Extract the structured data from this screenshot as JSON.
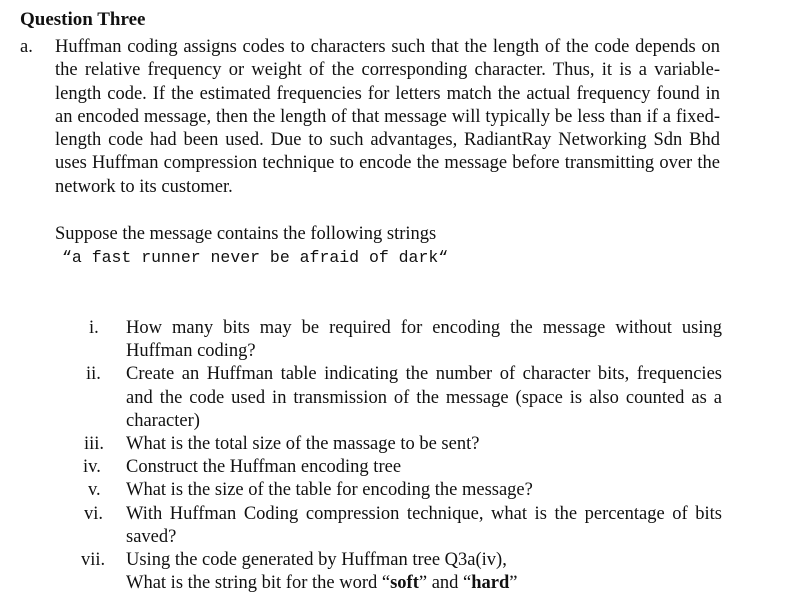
{
  "heading": "Question Three",
  "part": {
    "label": "a.",
    "paragraph": "Huffman coding assigns codes to characters such that the length of the code depends on the relative frequency or weight of the corresponding character. Thus, it is a variable-length code. If the estimated frequencies for letters match the actual frequency found in an encoded message, then the length of that message will typically be less than if a fixed-length code had been used. Due to such advantages, RadiantRay Networking Sdn Bhd  uses Huffman compression technique to encode the message before transmitting over the network to its customer.",
    "intro": "Suppose the message contains the following strings",
    "message_string": "“a fast runner never be afraid of dark“"
  },
  "questions": [
    {
      "num": "i.",
      "text": "How many bits may be required for encoding the message without using Huffman coding?"
    },
    {
      "num": "ii.",
      "text": "Create an Huffman table indicating  the number of character bits, frequencies and the code used in transmission of the message (space is also counted as a character)"
    },
    {
      "num": "iii.",
      "text": "What is the total size of the massage to be sent?"
    },
    {
      "num": "iv.",
      "text": "Construct the Huffman encoding tree"
    },
    {
      "num": "v.",
      "text": "What is the size of the table for encoding the message?"
    },
    {
      "num": "vi.",
      "text": "With Huffman Coding compression technique, what is the percentage of bits saved?"
    },
    {
      "num": "vii.",
      "text_line1": "Using the code generated by Huffman tree Q3a(iv),",
      "text_line2_prefix": "What is the string bit for the word “",
      "word1": "soft",
      "text_between": "” and “",
      "word2": "hard",
      "text_suffix": "”"
    }
  ]
}
